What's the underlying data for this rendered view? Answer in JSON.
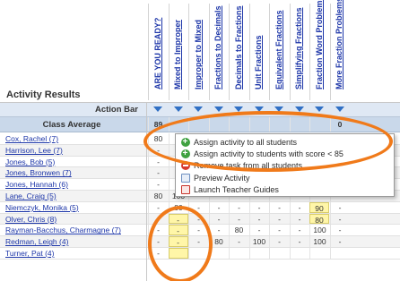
{
  "title": "Activity Results",
  "action_bar_label": "Action Bar",
  "class_average_label": "Class Average",
  "columns": [
    "ARE YOU READY?",
    "Mixed to Improper",
    "Improper to Mixed",
    "Fractions to Decimals",
    "Decimals to Fractions",
    "Unit Fractions",
    "Equivalent Fractions",
    "Simplifying Fractions",
    "Fraction Word Problems",
    "More Fraction Problems"
  ],
  "class_average": [
    "89",
    "",
    "",
    "",
    "",
    "",
    "",
    "",
    "",
    "0"
  ],
  "students": [
    {
      "name": "Cox, Rachel (7)",
      "cells": [
        "80",
        "",
        "",
        "",
        "",
        "",
        "",
        "",
        "",
        ""
      ]
    },
    {
      "name": "Harrison, Lee (7)",
      "cells": [
        "-",
        "",
        "",
        "",
        "",
        "",
        "",
        "",
        "",
        ""
      ]
    },
    {
      "name": "Jones, Bob (5)",
      "cells": [
        "-",
        "",
        "",
        "",
        "",
        "",
        "",
        "",
        "",
        ""
      ]
    },
    {
      "name": "Jones, Bronwen (7)",
      "cells": [
        "-",
        "",
        "",
        "",
        "",
        "",
        "",
        "",
        "",
        ""
      ]
    },
    {
      "name": "Jones, Hannah (6)",
      "cells": [
        "-",
        "",
        "",
        "",
        "",
        "",
        "",
        "",
        "",
        ""
      ]
    },
    {
      "name": "Lane, Craig (5)",
      "cells": [
        "80",
        "100",
        "",
        "",
        "",
        "",
        "",
        "",
        "",
        ""
      ]
    },
    {
      "name": "Niemczyk, Monika (5)",
      "cells": [
        "-",
        "80",
        "-",
        "-",
        "-",
        "-",
        "-",
        "-",
        "90",
        "-"
      ]
    },
    {
      "name": "Olver, Chris (8)",
      "cells": [
        "-",
        "-",
        "-",
        "-",
        "-",
        "-",
        "-",
        "-",
        "80",
        "-"
      ]
    },
    {
      "name": "Rayman-Bacchus, Charmagne (7)",
      "cells": [
        "-",
        "-",
        "-",
        "-",
        "80",
        "-",
        "-",
        "-",
        "100",
        "-"
      ]
    },
    {
      "name": "Redman, Leigh (4)",
      "cells": [
        "-",
        "-",
        "-",
        "80",
        "-",
        "100",
        "-",
        "-",
        "100",
        "-"
      ]
    },
    {
      "name": "Turner, Pat (4)",
      "cells": [
        "-",
        "",
        "",
        "",
        "",
        "",
        "",
        "",
        "",
        ""
      ]
    }
  ],
  "highlighted": [
    [
      7,
      1
    ],
    [
      8,
      1
    ],
    [
      9,
      1
    ],
    [
      6,
      8
    ],
    [
      7,
      8
    ],
    [
      10,
      1
    ]
  ],
  "menu": {
    "items": [
      {
        "label": "Assign activity to all students",
        "icon": "add-circle-icon"
      },
      {
        "label": "Assign activity to students with score < 85",
        "icon": "add-circle-icon"
      },
      {
        "label": "Remove task from all students",
        "icon": "remove-circle-icon"
      },
      {
        "label": "Preview Activity",
        "icon": "document-icon"
      },
      {
        "label": "Launch Teacher Guides",
        "icon": "pdf-icon"
      }
    ]
  },
  "colors": {
    "link": "#1c35a8",
    "highlight": "#fff6a8",
    "annotation": "#f07a1a",
    "header_blue": "#c9d8ea"
  }
}
